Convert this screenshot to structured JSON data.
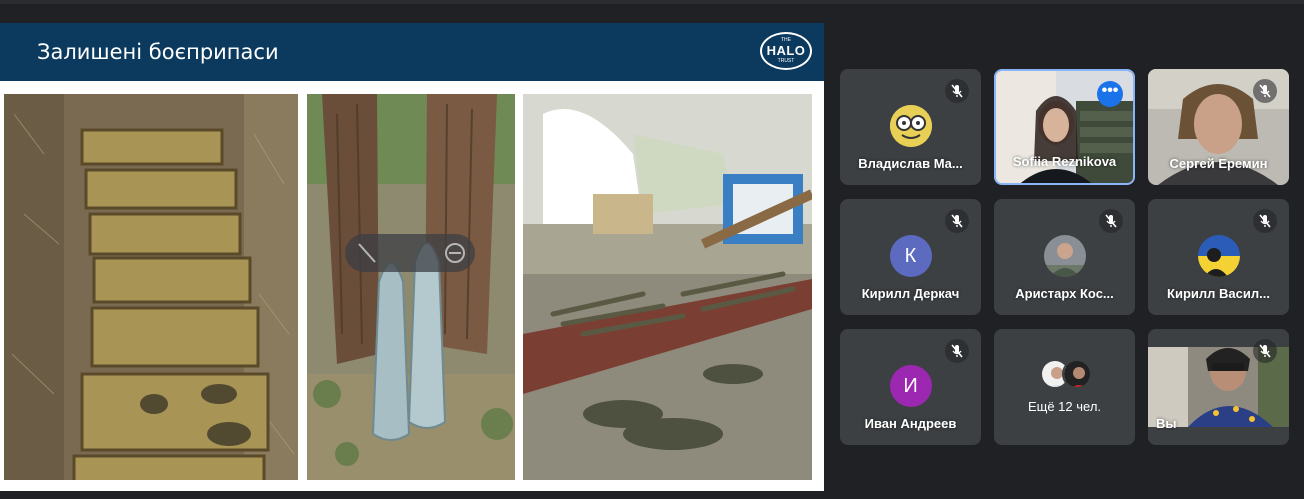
{
  "slide": {
    "title": "Залишені боєприпаси",
    "logo": {
      "the": "THE",
      "word": "HALO",
      "trust": "TRUST"
    }
  },
  "participants": [
    {
      "name": "Владислав Ма...",
      "avatar": "cartoon-avatar",
      "muted": true
    },
    {
      "name": "Sofiia Reznikova",
      "avatar": "camera-video",
      "muted": false,
      "active": true,
      "menu": "•••"
    },
    {
      "name": "Сергей Еремин",
      "avatar": "camera-video",
      "muted": true
    },
    {
      "name": "Кирилл Деркач",
      "avatar_letter": "К",
      "avatar_color": "#5c6bc0",
      "muted": true
    },
    {
      "name": "Аристарх Кос...",
      "avatar": "photo-avatar",
      "muted": true
    },
    {
      "name": "Кирилл Васил...",
      "avatar": "flag-avatar",
      "muted": true
    },
    {
      "name": "Иван Андреев",
      "avatar_letter": "И",
      "avatar_color": "#9c27b0",
      "muted": true
    },
    {
      "name": "Ещё 12 чел.",
      "avatar": "stacked-avatars"
    },
    {
      "name": "Вы",
      "avatar": "camera-video",
      "muted": true
    }
  ],
  "colors": {
    "background": "#202124",
    "tile": "#3c4043",
    "accent": "#8ab4f8",
    "slide_header": "#0b3a5e"
  }
}
